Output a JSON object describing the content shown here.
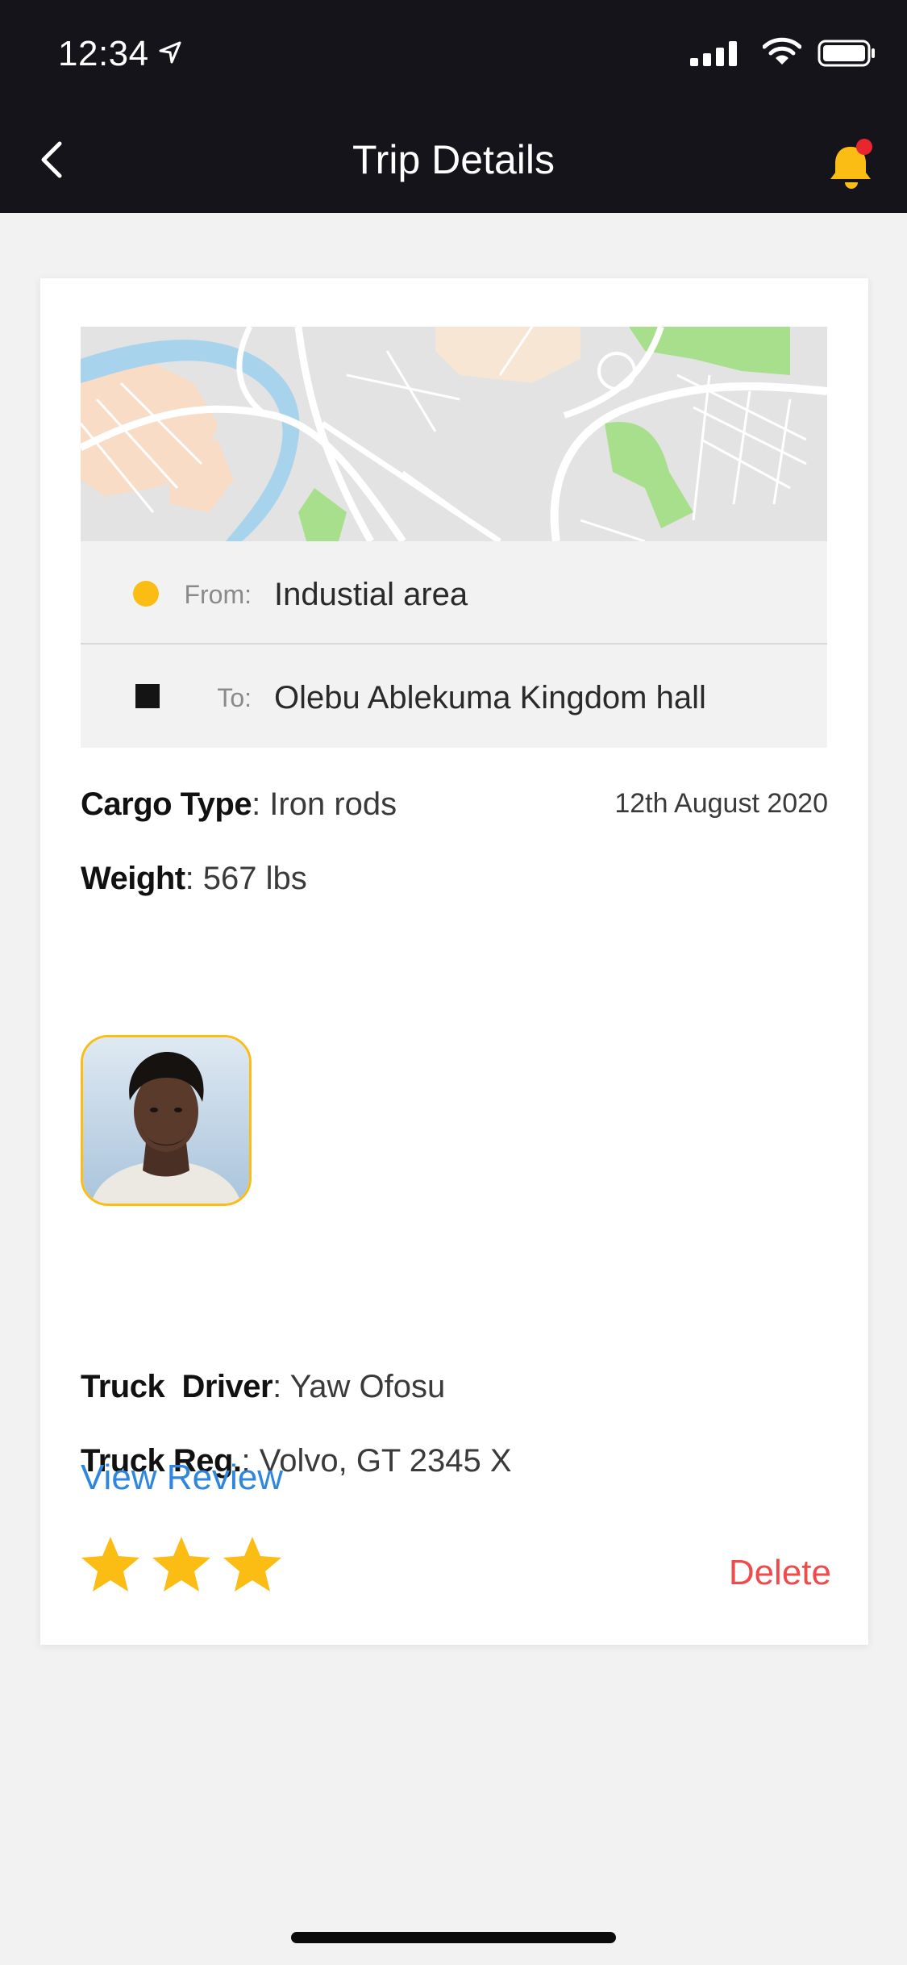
{
  "status_bar": {
    "time": "12:34",
    "icons": [
      "location-arrow-icon",
      "signal-icon",
      "wifi-icon",
      "battery-icon"
    ]
  },
  "nav": {
    "title": "Trip Details",
    "back_icon": "chevron-left-icon",
    "bell_icon": "bell-icon",
    "notification_dot": true
  },
  "route": {
    "from_label": "From:",
    "from_value": "Industial area",
    "to_label": "To:",
    "to_value": "Olebu Ablekuma Kingdom hall"
  },
  "cargo": {
    "type_label": "Cargo Type",
    "type_value": ": Iron rods",
    "weight_label": "Weight",
    "weight_value": ": 567 lbs",
    "date": "12th August 2020"
  },
  "driver": {
    "driver_label": "Truck  Driver",
    "driver_value": ": Yaw Ofosu",
    "reg_label": "Truck Reg.",
    "reg_value": ": Volvo, GT 2345 X"
  },
  "review": {
    "link_label": "View Review",
    "rating": 3,
    "delete_label": "Delete"
  },
  "colors": {
    "accent": "#fbbd14",
    "link": "#2e86de",
    "danger": "#f04b4b",
    "bar": "#14141a",
    "notification": "#e8262f"
  }
}
